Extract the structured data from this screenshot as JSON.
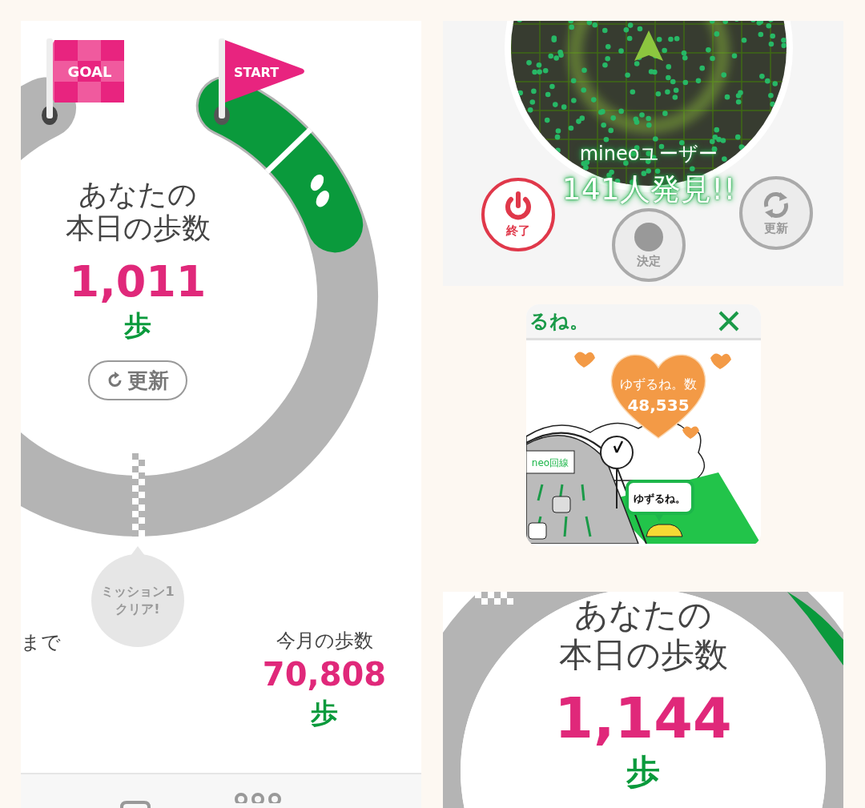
{
  "walk_panel": {
    "goal_flag": "GOAL",
    "start_flag": "START",
    "today_label": [
      "あなたの",
      "本日の歩数"
    ],
    "today_steps": "1,011",
    "steps_unit": "歩",
    "refresh_button": "更新",
    "mission_bubble": "ミッション1\nクリア!",
    "remaining_label": "まで",
    "month_label": "今月の歩数",
    "month_steps": "70,808",
    "month_unit": "歩"
  },
  "radar_panel": {
    "users_label": "mineoユーザー",
    "found_count": "141人発見!!",
    "buttons": [
      {
        "kind": "power",
        "label": "終了",
        "disabled": false
      },
      {
        "kind": "confirm",
        "label": "決定",
        "disabled": true
      },
      {
        "kind": "refresh",
        "label": "更新",
        "disabled": true
      }
    ]
  },
  "ad_card": {
    "title": "るね。",
    "heart_label": "ゆずるね。数",
    "heart_count": "48,535",
    "sign": "neo回線",
    "bubble": "ゆずるね。"
  },
  "bottom_panel": {
    "today_label": [
      "あなたの",
      "本日の歩数"
    ],
    "today_steps": "1,144",
    "steps_unit": "歩"
  }
}
